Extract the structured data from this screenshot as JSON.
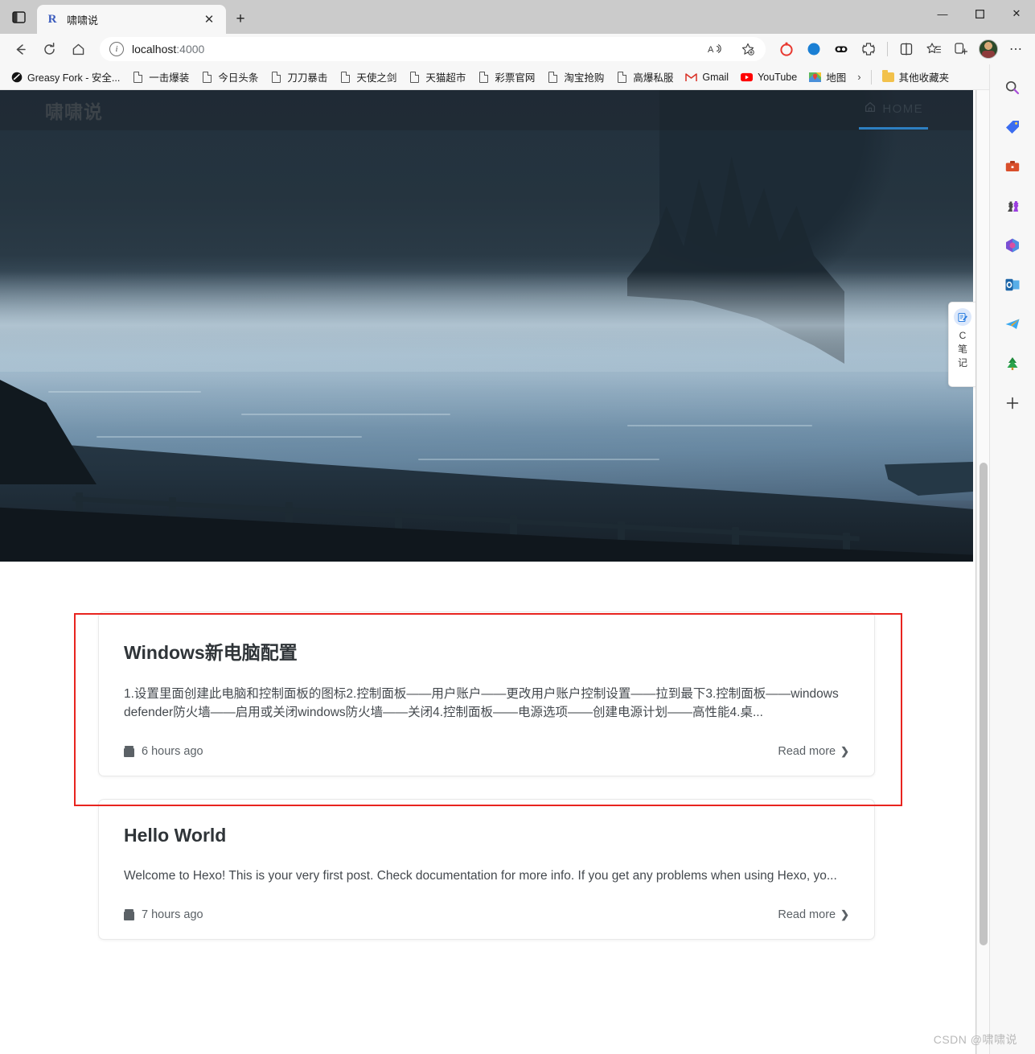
{
  "browser": {
    "tab": {
      "title": "啸啸说",
      "favicon": "R",
      "close_label": "✕"
    },
    "tab_strip_button": "▣",
    "new_tab_label": "+",
    "window_controls": {
      "minimize": "—",
      "maximize": "▢",
      "close": "✕"
    },
    "nav": {
      "back": "←",
      "refresh": "⟳",
      "home": "⌂"
    },
    "omnibox": {
      "url_main": "localhost",
      "url_port": ":4000",
      "info_icon": "i",
      "read_aloud": "A",
      "add_favorite": "☆"
    },
    "toolbar_icons": [
      {
        "name": "extension-red-icon",
        "glyph": "◌"
      },
      {
        "name": "extension-blue-icon",
        "glyph": "◕"
      },
      {
        "name": "extension-dots-icon",
        "glyph": "◓"
      },
      {
        "name": "extensions-puzzle-icon",
        "glyph": "⧉"
      },
      {
        "name": "split-screen-icon",
        "glyph": "▯"
      },
      {
        "name": "favorites-icon",
        "glyph": "☆"
      },
      {
        "name": "collections-icon",
        "glyph": "⎘"
      }
    ],
    "settings_more": "⋯",
    "bookmarks": [
      {
        "label": "Greasy Fork - 安全...",
        "icon": "greasyfork-icon"
      },
      {
        "label": "一击爆装",
        "icon": "page-icon"
      },
      {
        "label": "今日头条",
        "icon": "page-icon"
      },
      {
        "label": "刀刀暴击",
        "icon": "page-icon"
      },
      {
        "label": "天使之剑",
        "icon": "page-icon"
      },
      {
        "label": "天猫超市",
        "icon": "page-icon"
      },
      {
        "label": "彩票官网",
        "icon": "page-icon"
      },
      {
        "label": "淘宝抢购",
        "icon": "page-icon"
      },
      {
        "label": "高爆私服",
        "icon": "page-icon"
      },
      {
        "label": "Gmail",
        "icon": "gmail-icon"
      },
      {
        "label": "YouTube",
        "icon": "youtube-icon"
      },
      {
        "label": "地图",
        "icon": "maps-icon"
      }
    ],
    "bookmarks_overflow": "›",
    "other_bookmarks": "其他收藏夹",
    "sidebar_icons": [
      {
        "name": "search-icon",
        "glyph": "🔍"
      },
      {
        "name": "shopping-tag-icon",
        "glyph": "🏷"
      },
      {
        "name": "tools-briefcase-icon",
        "glyph": "🧰"
      },
      {
        "name": "games-icon",
        "glyph": "♟"
      },
      {
        "name": "microsoft-365-icon",
        "glyph": "✿"
      },
      {
        "name": "outlook-icon",
        "glyph": "📧"
      },
      {
        "name": "telegram-icon",
        "glyph": "✈"
      },
      {
        "name": "tree-icon",
        "glyph": "🌲"
      },
      {
        "name": "add-sidebar-app-icon",
        "glyph": "+"
      }
    ]
  },
  "page": {
    "site_title": "啸啸说",
    "nav": {
      "home_label": "HOME",
      "home_icon": "home-icon"
    },
    "posts": [
      {
        "title": "Windows新电脑配置",
        "excerpt": "1.设置里面创建此电脑和控制面板的图标2.控制面板——用户账户——更改用户账户控制设置——拉到最下3.控制面板——windows defender防火墙——启用或关闭windows防火墙——关闭4.控制面板——电源选项——创建电源计划——高性能4.桌...",
        "date": "6 hours ago",
        "read_more": "Read more"
      },
      {
        "title": "Hello World",
        "excerpt": "Welcome to Hexo! This is your very first post. Check documentation for more info. If you get any problems when using Hexo, yo...",
        "date": "7 hours ago",
        "read_more": "Read more"
      }
    ],
    "note_widget": {
      "icon": "note-pen-icon",
      "line1": "C",
      "line2": "笔",
      "line3": "记"
    },
    "highlight_color": "#e8241f"
  },
  "watermark": "CSDN @啸啸说"
}
